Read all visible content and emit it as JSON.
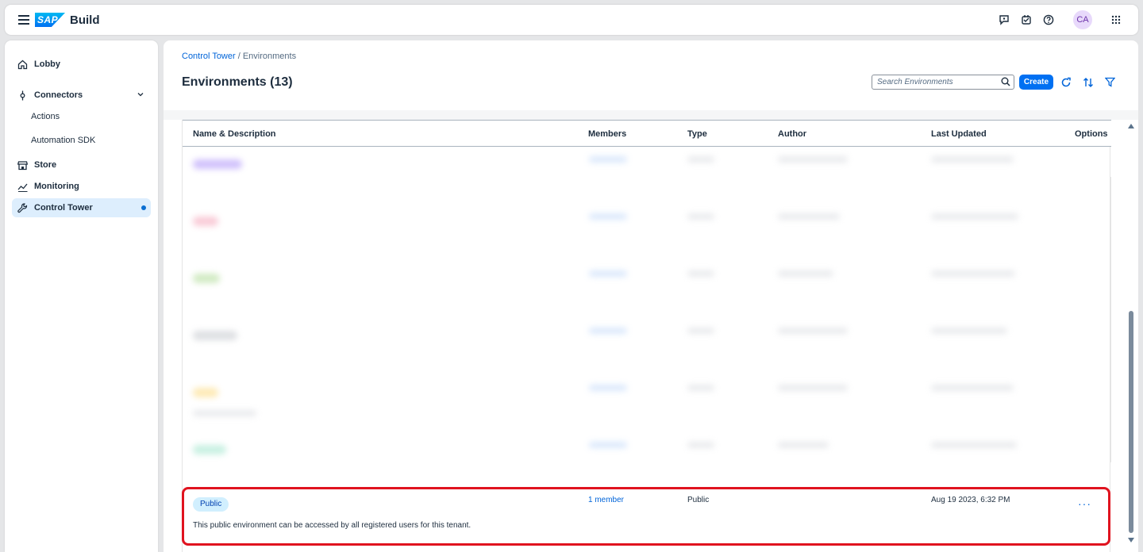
{
  "shell": {
    "product_logo": "SAP",
    "product_name": "Build",
    "avatar_initials": "CA"
  },
  "sidebar": {
    "items": [
      {
        "label": "Lobby"
      },
      {
        "label": "Connectors"
      },
      {
        "label": "Actions"
      },
      {
        "label": "Automation SDK"
      },
      {
        "label": "Store"
      },
      {
        "label": "Monitoring"
      },
      {
        "label": "Control Tower"
      }
    ]
  },
  "breadcrumb": {
    "parent": "Control Tower",
    "separator": " / ",
    "current": "Environments"
  },
  "page": {
    "title": "Environments (13)"
  },
  "toolbar": {
    "search_placeholder": "Search Environments",
    "create_label": "Create"
  },
  "table": {
    "columns": [
      "Name & Description",
      "Members",
      "Type",
      "Author",
      "Last Updated",
      "Options"
    ],
    "visible_row": {
      "badge": "Public",
      "description": "This public environment can be accessed by all registered users for this tenant.",
      "members": "1 member",
      "type": "Public",
      "author": "",
      "last_updated": "Aug 19 2023, 6:32 PM",
      "options": "···"
    }
  },
  "colors": {
    "accent": "#0070f2",
    "link": "#0064d9",
    "highlight": "#e0131f",
    "selected_nav": "#ddeefd"
  }
}
